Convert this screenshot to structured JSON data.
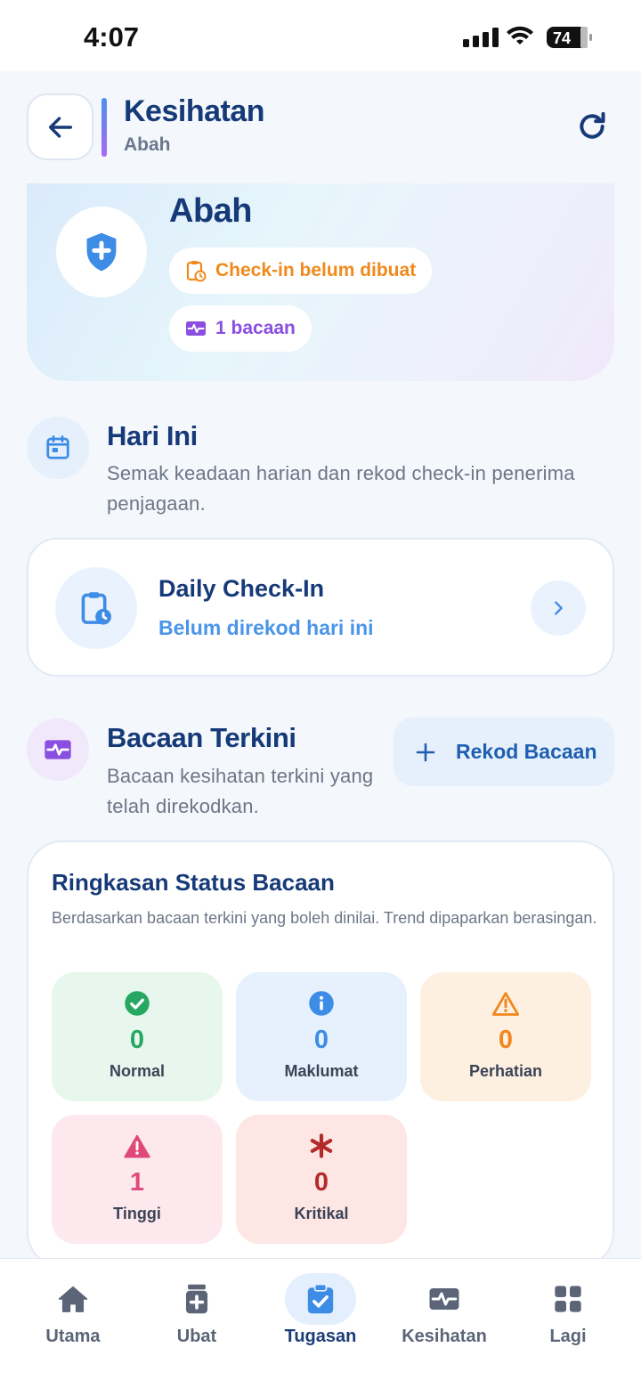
{
  "status_bar": {
    "time": "4:07",
    "battery": "74"
  },
  "header": {
    "title": "Kesihatan",
    "subtitle": "Abah"
  },
  "hero": {
    "name": "Abah",
    "checkin_status": "Check-in belum dibuat",
    "readings_count": "1 bacaan"
  },
  "today": {
    "title": "Hari Ini",
    "description": "Semak keadaan harian dan rekod check-in penerima penjagaan.",
    "card_title": "Daily Check-In",
    "card_status": "Belum direkod hari ini"
  },
  "readings": {
    "title": "Bacaan Terkini",
    "description": "Bacaan kesihatan terkini yang telah direkodkan.",
    "record_button": "Rekod Bacaan"
  },
  "summary": {
    "title": "Ringkasan Status Bacaan",
    "description": "Berdasarkan bacaan terkini yang boleh dinilai. Trend dipaparkan berasingan.",
    "tiles": [
      {
        "label": "Normal",
        "count": "0",
        "icon": "check-circle-icon",
        "color": "#27a862",
        "bg": "#e8f7ee"
      },
      {
        "label": "Maklumat",
        "count": "0",
        "icon": "info-icon",
        "color": "#3d8ce6",
        "bg": "#e6f1fd"
      },
      {
        "label": "Perhatian",
        "count": "0",
        "icon": "warning-outline-icon",
        "color": "#f0871f",
        "bg": "#fdf0e1"
      },
      {
        "label": "Tinggi",
        "count": "1",
        "icon": "warning-filled-icon",
        "color": "#e0487a",
        "bg": "#fde8ee"
      },
      {
        "label": "Kritikal",
        "count": "0",
        "icon": "asterisk-icon",
        "color": "#b42a2a",
        "bg": "#fde6e4"
      }
    ]
  },
  "nav": {
    "items": [
      {
        "label": "Utama",
        "icon": "home-icon"
      },
      {
        "label": "Ubat",
        "icon": "medicine-icon"
      },
      {
        "label": "Tugasan",
        "icon": "task-icon",
        "active": true
      },
      {
        "label": "Kesihatan",
        "icon": "pulse-icon"
      },
      {
        "label": "Lagi",
        "icon": "grid-icon"
      }
    ]
  }
}
